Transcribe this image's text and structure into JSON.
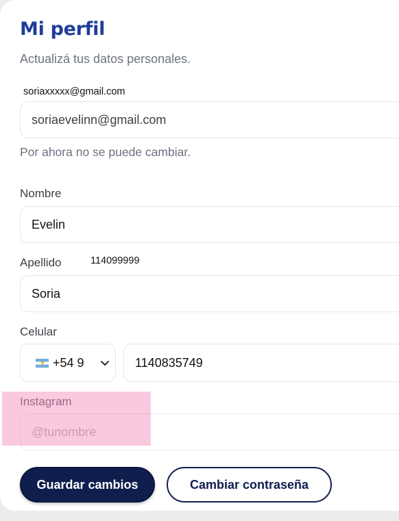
{
  "profile": {
    "title": "Mi perfil",
    "subtitle": "Actualizá tus datos personales."
  },
  "annotations": {
    "email_note": "soriaxxxxx@gmail.com",
    "phone_note": "114099999"
  },
  "email": {
    "value": "soriaevelinn@gmail.com",
    "helper": "Por ahora no se puede cambiar."
  },
  "nombre": {
    "label": "Nombre",
    "value": "Evelin"
  },
  "apellido": {
    "label": "Apellido",
    "value": "Soria"
  },
  "celular": {
    "label": "Celular",
    "country_flag": "argentina-flag-icon",
    "country_code": "+54 9",
    "number": "1140835749"
  },
  "instagram": {
    "label": "Instagram",
    "placeholder": "@tunombre",
    "value": ""
  },
  "actions": {
    "save_label": "Guardar cambios",
    "change_password_label": "Cambiar contraseña"
  },
  "colors": {
    "title": "#1f3d99",
    "primary_button": "#0f1e4d",
    "highlight": "#f496c0"
  }
}
